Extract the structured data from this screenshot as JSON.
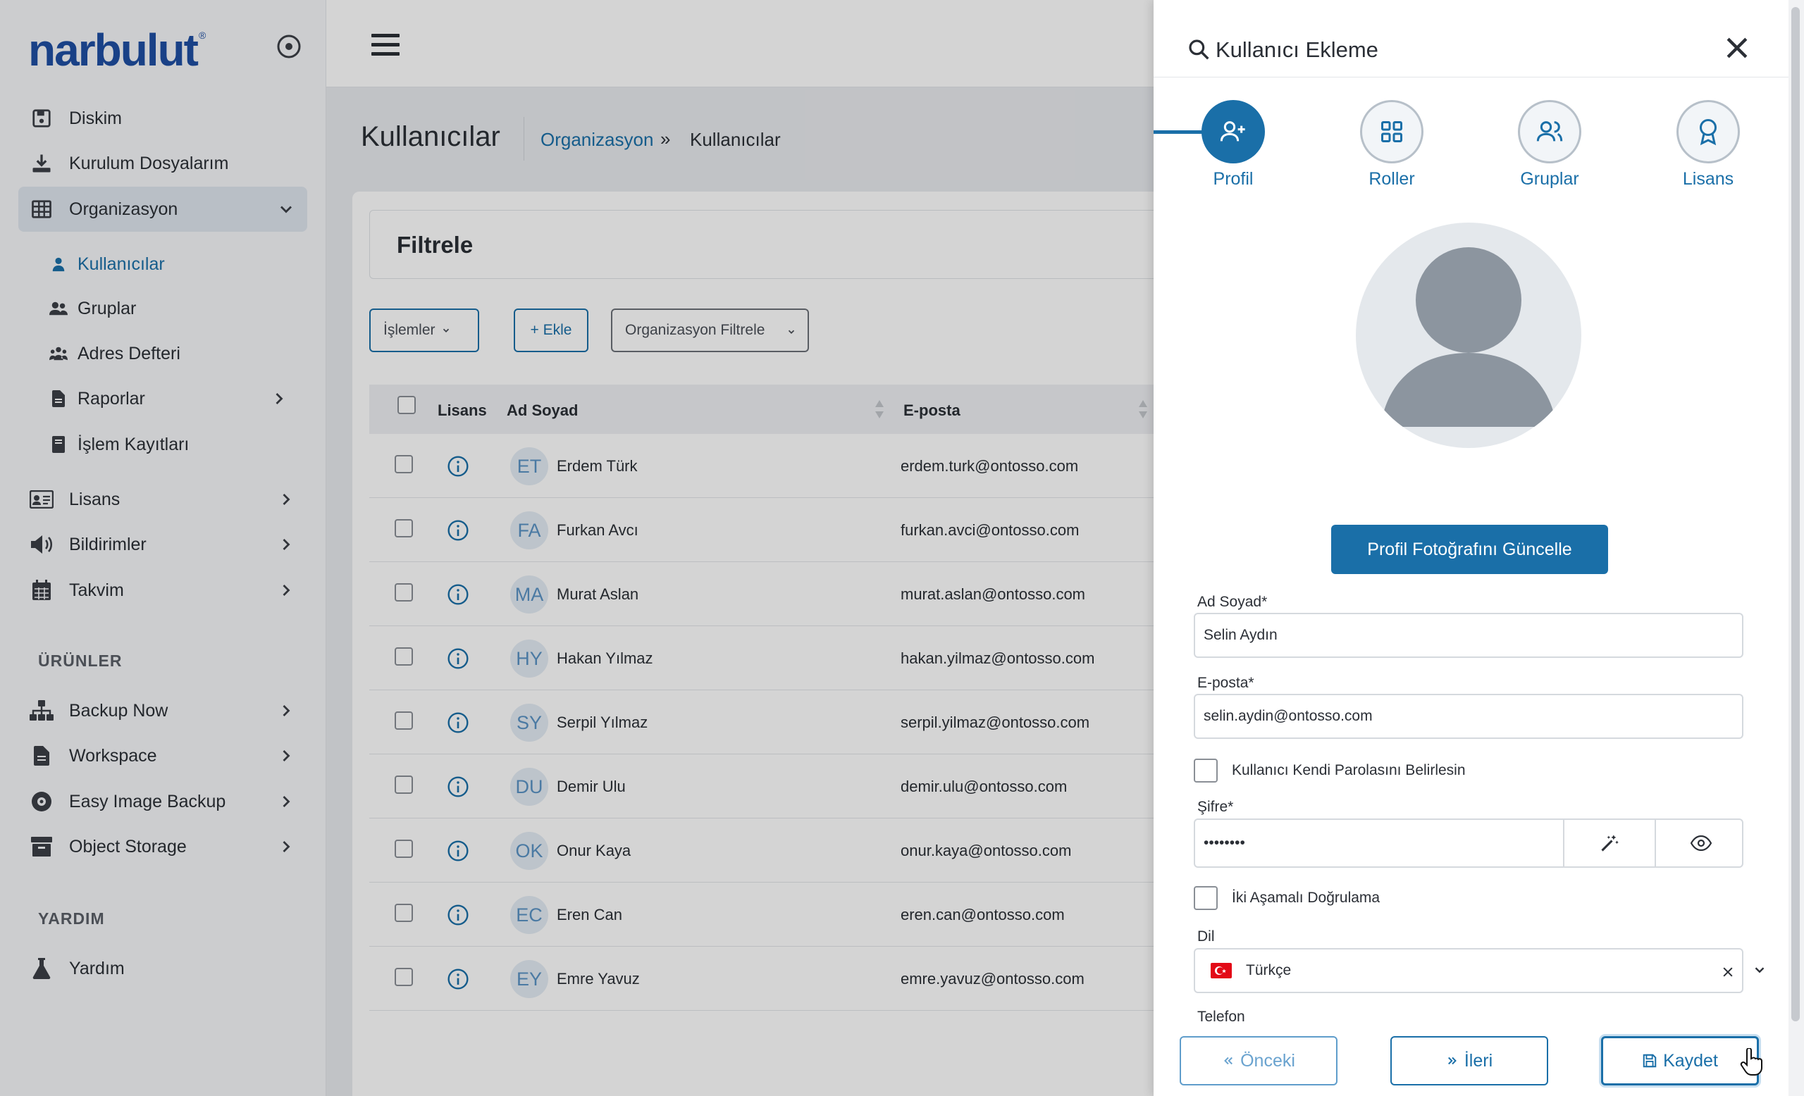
{
  "brand": {
    "name": "narbulut",
    "mark": "®"
  },
  "sidebar": {
    "items": [
      {
        "label": "Diskim",
        "icon": "disk-icon"
      },
      {
        "label": "Kurulum Dosyalarım",
        "icon": "download-icon"
      },
      {
        "label": "Organizasyon",
        "icon": "grid-table-icon"
      },
      {
        "label": "Lisans",
        "icon": "id-card-icon"
      },
      {
        "label": "Bildirimler",
        "icon": "megaphone-icon"
      },
      {
        "label": "Takvim",
        "icon": "calendar-icon"
      }
    ],
    "sub_items": [
      {
        "label": "Kullanıcılar",
        "icon": "user-icon"
      },
      {
        "label": "Gruplar",
        "icon": "users-icon"
      },
      {
        "label": "Adres Defteri",
        "icon": "address-book-icon"
      },
      {
        "label": "Raporlar",
        "icon": "report-icon"
      },
      {
        "label": "İşlem Kayıtları",
        "icon": "log-book-icon"
      }
    ],
    "section_products": "ÜRÜNLER",
    "products": [
      {
        "label": "Backup Now",
        "icon": "sitemap-icon"
      },
      {
        "label": "Workspace",
        "icon": "document-icon"
      },
      {
        "label": "Easy Image Backup",
        "icon": "disc-icon"
      },
      {
        "label": "Object Storage",
        "icon": "archive-icon"
      }
    ],
    "section_help": "YARDIM",
    "help": [
      {
        "label": "Yardım",
        "icon": "flask-icon"
      }
    ]
  },
  "main": {
    "title": "Kullanıcılar",
    "breadcrumb": {
      "link": "Organizasyon",
      "separator": "»",
      "current": "Kullanıcılar"
    },
    "filter_title": "Filtrele",
    "actions": {
      "operations": "İşlemler",
      "add": "+ Ekle",
      "org_filter": "Organizasyon Filtrele"
    },
    "table": {
      "headers": {
        "license": "Lisans",
        "name": "Ad Soyad",
        "email": "E-posta"
      },
      "rows": [
        {
          "initials": "ET",
          "name": "Erdem Türk",
          "email": "erdem.turk@ontosso.com"
        },
        {
          "initials": "FA",
          "name": "Furkan Avcı",
          "email": "furkan.avci@ontosso.com"
        },
        {
          "initials": "MA",
          "name": "Murat Aslan",
          "email": "murat.aslan@ontosso.com"
        },
        {
          "initials": "HY",
          "name": "Hakan Yılmaz",
          "email": "hakan.yilmaz@ontosso.com"
        },
        {
          "initials": "SY",
          "name": "Serpil Yılmaz",
          "email": "serpil.yilmaz@ontosso.com"
        },
        {
          "initials": "DU",
          "name": "Demir Ulu",
          "email": "demir.ulu@ontosso.com"
        },
        {
          "initials": "OK",
          "name": "Onur Kaya",
          "email": "onur.kaya@ontosso.com"
        },
        {
          "initials": "EC",
          "name": "Eren Can",
          "email": "eren.can@ontosso.com"
        },
        {
          "initials": "EY",
          "name": "Emre Yavuz",
          "email": "emre.yavuz@ontosso.com"
        }
      ]
    }
  },
  "drawer": {
    "title": "Kullanıcı Ekleme",
    "steps": [
      {
        "label": "Profil",
        "icon": "user-plus-icon",
        "active": true
      },
      {
        "label": "Roller",
        "icon": "grid-icon",
        "active": false
      },
      {
        "label": "Gruplar",
        "icon": "users-icon",
        "active": false
      },
      {
        "label": "Lisans",
        "icon": "award-icon",
        "active": false
      }
    ],
    "update_photo": "Profil Fotoğrafını Güncelle",
    "fields": {
      "name_label": "Ad Soyad*",
      "name_value": "Selin Aydın",
      "email_label": "E-posta*",
      "email_value": "selin.aydin@ontosso.com",
      "self_password": "Kullanıcı Kendi Parolasını Belirlesin",
      "password_label": "Şifre*",
      "password_value": "••••••••",
      "two_factor": "İki Aşamalı Doğrulama",
      "lang_label": "Dil",
      "lang_value": "Türkçe",
      "phone_label": "Telefon"
    },
    "footer": {
      "prev": "Önceki",
      "next": "İleri",
      "save": "Kaydet"
    }
  },
  "colors": {
    "accent": "#1a6fa8",
    "brand": "#1f4fa3",
    "flag_tr": "#e30a17"
  }
}
